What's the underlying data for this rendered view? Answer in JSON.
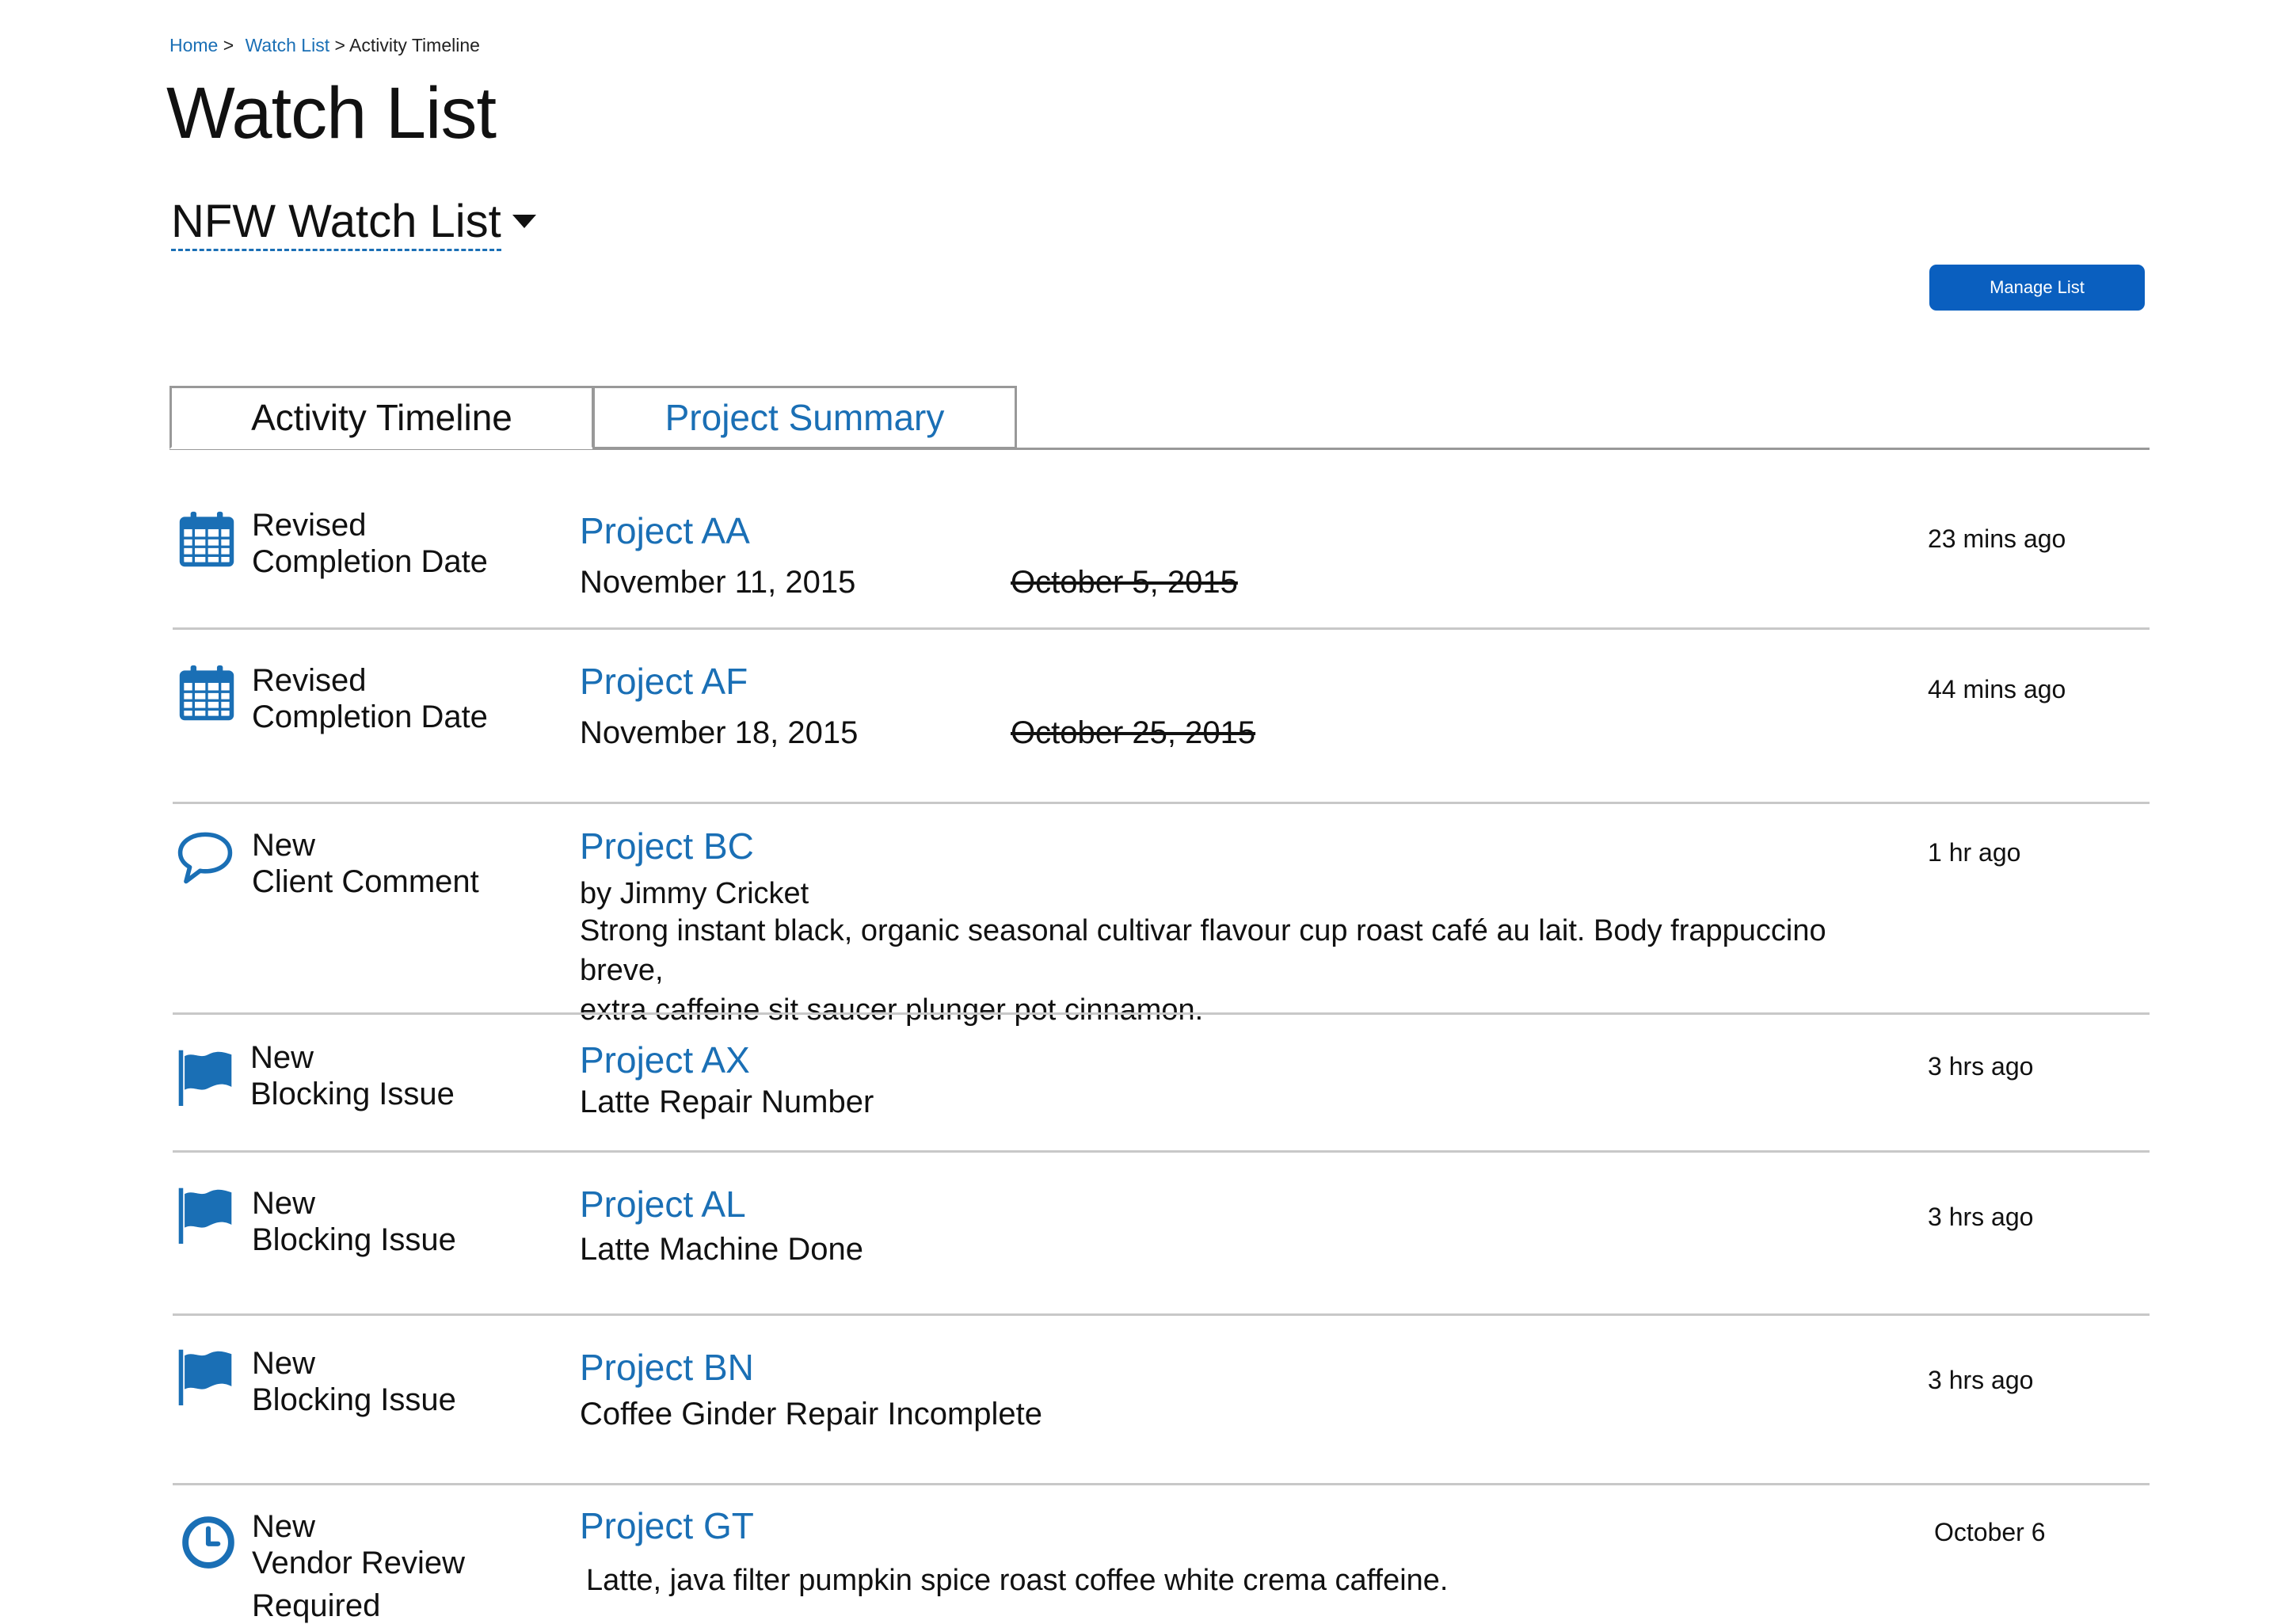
{
  "breadcrumb": {
    "items": [
      "Home",
      "Watch List"
    ],
    "separator": ">",
    "current": "Activity Timeline"
  },
  "page_title": "Watch List",
  "list_selector": {
    "value": "NFW Watch List"
  },
  "manage_button": {
    "label": "Manage List"
  },
  "tabs": [
    {
      "label": "Activity Timeline",
      "active": true
    },
    {
      "label": "Project Summary",
      "active": false
    }
  ],
  "colors": {
    "link": "#1a6fb5",
    "button": "#0a5fbf",
    "icon": "#1a6fb5",
    "divider": "#c8c8c8"
  },
  "timeline": [
    {
      "icon": "calendar-icon",
      "type_line1": "Revised",
      "type_line2": "Completion Date",
      "type_line3": "",
      "project": "Project AA",
      "new_date": "November 11, 2015",
      "old_date": "October 5, 2015",
      "time": "23 mins ago"
    },
    {
      "icon": "calendar-icon",
      "type_line1": "Revised",
      "type_line2": "Completion Date",
      "type_line3": "",
      "project": "Project AF",
      "new_date": "November 18, 2015",
      "old_date": "October 25, 2015",
      "time": "44 mins ago"
    },
    {
      "icon": "comment-icon",
      "type_line1": "New",
      "type_line2": "Client Comment",
      "type_line3": "",
      "project": "Project BC",
      "author": "by Jimmy Cricket",
      "comment_line1": "Strong instant black, organic seasonal cultivar flavour cup roast café au lait. Body frappuccino breve,",
      "comment_line2": "extra caffeine sit saucer plunger pot cinnamon.",
      "time": "1 hr ago"
    },
    {
      "icon": "flag-icon",
      "type_line1": "New",
      "type_line2": "Blocking Issue",
      "type_line3": "",
      "project": "Project AX",
      "detail": "Latte Repair Number",
      "time": "3 hrs ago"
    },
    {
      "icon": "flag-icon",
      "type_line1": "New",
      "type_line2": "Blocking Issue",
      "type_line3": "",
      "project": "Project AL",
      "detail": "Latte Machine Done",
      "time": "3 hrs ago"
    },
    {
      "icon": "flag-icon",
      "type_line1": "New",
      "type_line2": "Blocking Issue",
      "type_line3": "",
      "project": "Project BN",
      "detail": "Coffee Ginder Repair Incomplete",
      "time": "3 hrs ago"
    },
    {
      "icon": "clock-icon",
      "type_line1": "New",
      "type_line2": "Vendor Review",
      "type_line3": "Required",
      "project": "Project GT",
      "detail": "Latte, java filter pumpkin spice roast coffee white crema caffeine.",
      "time": "October 6"
    }
  ]
}
